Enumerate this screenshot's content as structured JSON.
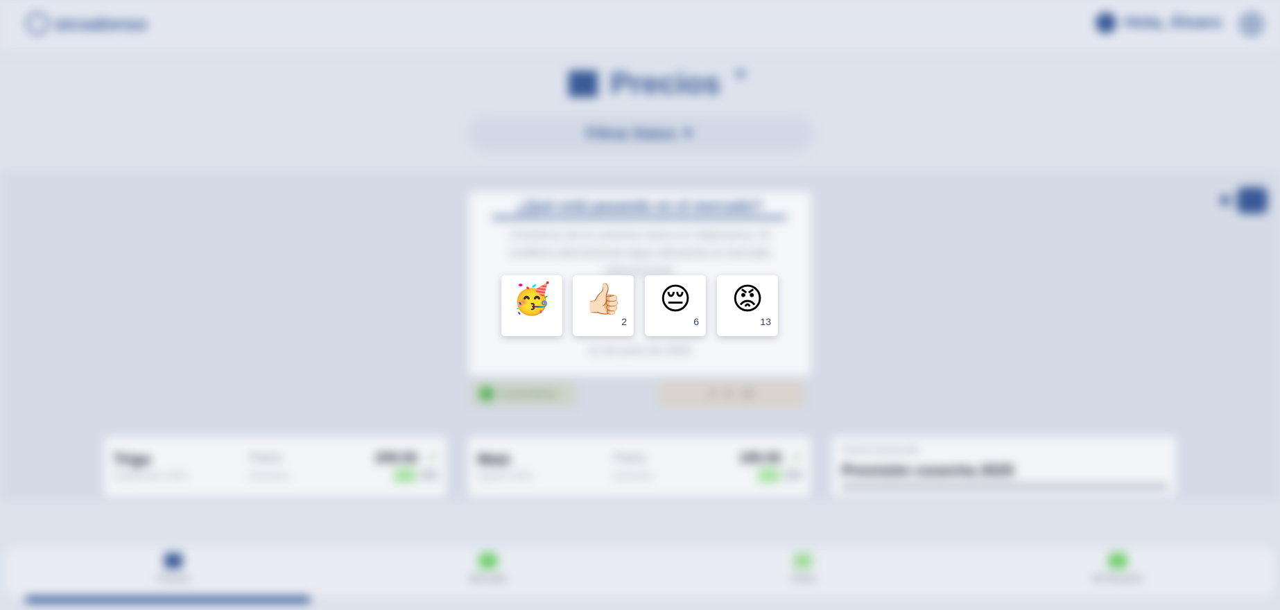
{
  "header": {
    "logo_text": "sicsalonso",
    "greeting": "Hola, Álvaro"
  },
  "page": {
    "title": "Precios",
    "filter_label": "Filtrar Datos ▼"
  },
  "news": {
    "heading": "¿Qué está pasando en el mercado?",
    "body": "Comienzo de la cosecha nueva en Salamanca. El conflicto internacional sigue afectando al mercado internacional.",
    "date": "11 de junio de 2025",
    "comment_label": "Comentarios",
    "summary": [
      "2",
      "6",
      "13"
    ]
  },
  "prices": [
    {
      "name": "Trigo",
      "sub": "Septiembre 2025",
      "market": "París",
      "market_sub": "Euronext",
      "value": "209.50"
    },
    {
      "name": "Maíz",
      "sub": "Agosto 2025",
      "market": "París",
      "market_sub": "Euronext",
      "value": "195.50"
    }
  ],
  "side_news": {
    "tag": "Noticia destacada",
    "title": "Previsión cosecha 2025"
  },
  "nav": [
    "Precios",
    "Mercado",
    "Clima",
    "Mi Almacén"
  ],
  "reactions": [
    {
      "emoji": "🥳",
      "icon": "party-face-icon",
      "count": ""
    },
    {
      "emoji": "👍🏻",
      "icon": "thumbs-up-icon",
      "count": "2"
    },
    {
      "emoji": "😔",
      "icon": "pensive-face-icon",
      "count": "6"
    },
    {
      "emoji": "😡",
      "icon": "angry-face-icon",
      "count": "13"
    }
  ],
  "colors": {
    "accent": "#3a5a97",
    "background": "#dde3ed",
    "up": "#4caf50"
  }
}
